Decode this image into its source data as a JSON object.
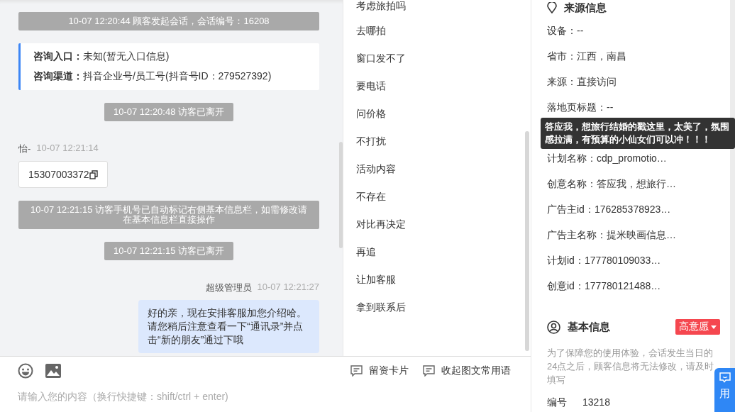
{
  "chat": {
    "messages": [
      {
        "kind": "system",
        "text": "10-07 12:20:44 顾客发起会话，会话编号：16208"
      },
      {
        "kind": "entry_card",
        "lines": [
          {
            "label": "咨询入口：",
            "value": "未知(暂无入口信息)"
          },
          {
            "label": "咨询渠道：",
            "value": "抖音企业号/员工号(抖音号ID：279527392)"
          }
        ]
      },
      {
        "kind": "system",
        "text": "10-07 12:20:48 访客已离开"
      },
      {
        "kind": "visitor",
        "sender": "怡-",
        "time": "10-07 12:21:14",
        "text": "15307003372"
      },
      {
        "kind": "system",
        "text": "10-07 12:21:15 访客手机号已自动标记右侧基本信息栏，如需修改请在基本信息栏直接操作"
      },
      {
        "kind": "system",
        "text": "10-07 12:21:15 访客已离开"
      },
      {
        "kind": "agent",
        "sender": "超级管理员",
        "time": "10-07 12:21:27",
        "text": "好的亲，现在安排客服加您介绍哈。请您稍后注意查看一下“通讯录”并点击“新的朋友”通过下哦"
      }
    ]
  },
  "quick_replies": [
    "考虑旅拍吗",
    "去哪拍",
    "窗口发不了",
    "要电话",
    "问价格",
    "不打扰",
    "活动内容",
    "不存在",
    "对比再决定",
    "再追",
    "让加客服",
    "拿到联系后"
  ],
  "composer": {
    "placeholder": "请输入您的内容（换行快捷键：shift/ctrl + enter)",
    "actions": [
      "留资卡片",
      "收起图文常用语"
    ]
  },
  "source_info": {
    "title": "来源信息",
    "fields": [
      "设备：--",
      "省市：江西，南昌",
      "来源：直接访问",
      "落地页标题：--",
      "计划名称：cdp_promotio…",
      "创意名称：答应我，想旅行…",
      "广告主id：176285378923…",
      "广告主名称：提米映画信息…",
      "计划id：177780109033…",
      "创意id：177780121488…"
    ]
  },
  "tooltip": "答应我，想旅行结婚的戳这里，太美了，氛围感拉满，有预算的小仙女们可以冲！！！",
  "basic_info": {
    "title": "基本信息",
    "intent_tag": "高意愿",
    "notice": "为了保障您的使用体验，会话发生当日的24点之后，顾客信息将无法修改，请及时填写",
    "fields": [
      {
        "label": "编号",
        "value": "13218"
      }
    ]
  },
  "side_tab": "用"
}
